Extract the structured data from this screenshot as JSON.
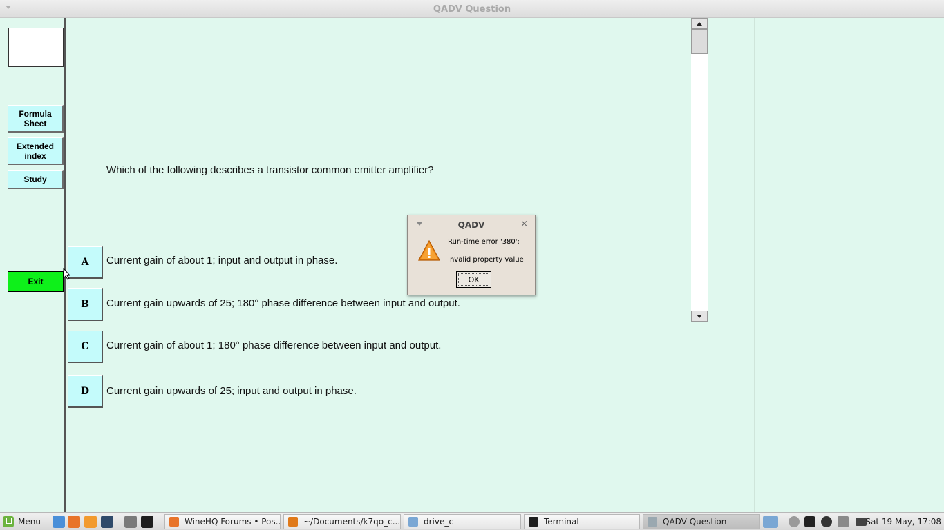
{
  "window": {
    "title": "QADV Question"
  },
  "sidebar": {
    "formula_sheet": "Formula\nSheet",
    "extended_index": "Extended\nindex",
    "study": "Study",
    "exit": "Exit"
  },
  "question": {
    "text": "Which of the following describes a transistor common emitter amplifier?",
    "answers": [
      {
        "letter": "A",
        "text": "Current gain of about 1;   input and output in phase."
      },
      {
        "letter": "B",
        "text": "Current gain upwards of 25;   180° phase difference between input and output."
      },
      {
        "letter": "C",
        "text": "Current gain of about 1;   180° phase difference between input and output."
      },
      {
        "letter": "D",
        "text": "Current gain upwards of 25;   input and output in phase."
      }
    ]
  },
  "dialog": {
    "title": "QADV",
    "close": "×",
    "line1": "Run-time error '380':",
    "line2": "Invalid property value",
    "ok": "OK"
  },
  "taskbar": {
    "menu": "Menu",
    "windows": [
      {
        "label": "WineHQ Forums • Pos...",
        "icon": "firefox-icon"
      },
      {
        "label": "~/Documents/k7qo_c...",
        "icon": "sublime-icon"
      },
      {
        "label": "drive_c",
        "icon": "folder-icon"
      },
      {
        "label": "Terminal",
        "icon": "terminal-icon"
      },
      {
        "label": "QADV Question",
        "icon": "wine-icon"
      }
    ],
    "clock": "Sat 19 May, 17:08"
  },
  "colors": {
    "background": "#e0f8ee",
    "button": "#c4fbfb",
    "exit_button": "#0ef01a"
  }
}
